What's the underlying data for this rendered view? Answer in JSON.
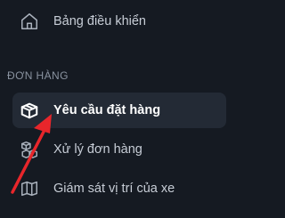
{
  "sidebar": {
    "items": [
      {
        "label": "Bảng điều khiển",
        "icon": "home-icon"
      },
      {
        "label": "Yêu cầu đặt hàng",
        "icon": "box-icon",
        "active": true
      },
      {
        "label": "Xử lý đơn hàng",
        "icon": "boxes-icon"
      },
      {
        "label": "Giám sát vị trí của xe",
        "icon": "map-icon"
      }
    ],
    "sections": [
      {
        "label": "ĐƠN HÀNG"
      }
    ]
  },
  "annotation": {
    "arrow_color": "#e8262b",
    "target": "sidebar-item-order-request"
  },
  "colors": {
    "background": "#151a22",
    "active_background": "#232a35",
    "text": "#c7cdd6",
    "section_text": "#8a93a0"
  }
}
